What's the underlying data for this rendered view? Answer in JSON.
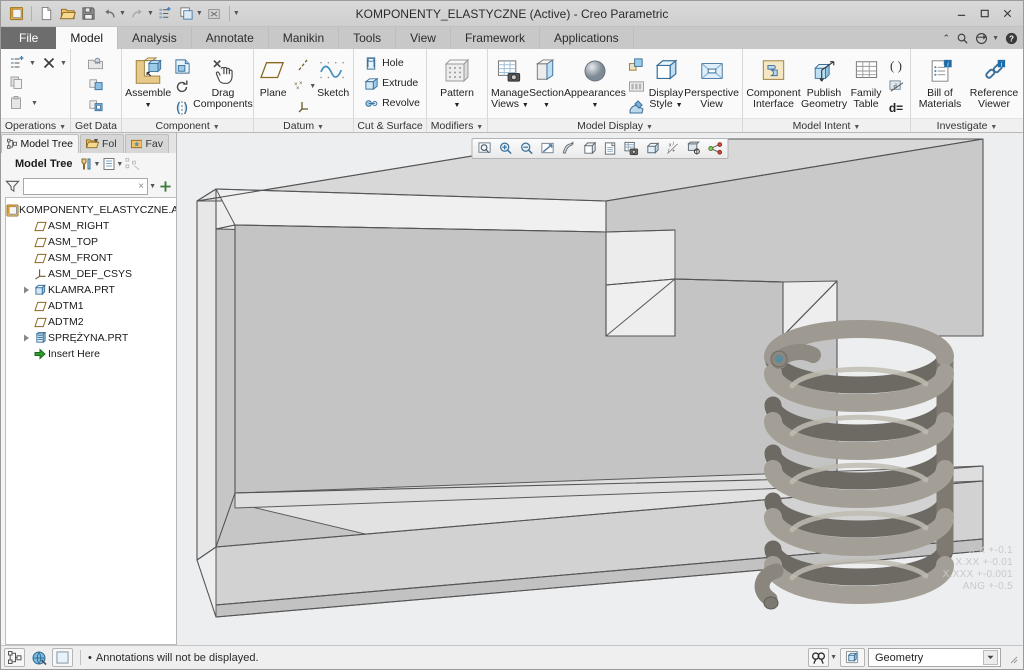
{
  "window": {
    "title": "KOMPONENTY_ELASTYCZNE (Active) - Creo Parametric",
    "minimize_label": "—",
    "maximize_label": "❑",
    "close_label": "✕"
  },
  "quick_access": {
    "items": [
      {
        "name": "creo-logo-icon",
        "label": "Creo"
      },
      {
        "name": "new-icon",
        "label": "New"
      },
      {
        "name": "open-icon",
        "label": "Open"
      },
      {
        "name": "save-icon",
        "label": "Save"
      },
      {
        "name": "undo-icon",
        "label": "Undo"
      },
      {
        "name": "redo-icon",
        "label": "Redo"
      },
      {
        "name": "regenerate-icon",
        "label": "Regenerate"
      },
      {
        "name": "window-switch-icon",
        "label": "Switch Window"
      },
      {
        "name": "close-window-icon",
        "label": "Close"
      },
      {
        "name": "customize-qat-icon",
        "label": "Customize Quick Access Toolbar"
      }
    ]
  },
  "tabs": [
    {
      "label": "File",
      "active": false,
      "file": true
    },
    {
      "label": "Model",
      "active": true
    },
    {
      "label": "Analysis",
      "active": false
    },
    {
      "label": "Annotate",
      "active": false
    },
    {
      "label": "Manikin",
      "active": false
    },
    {
      "label": "Tools",
      "active": false
    },
    {
      "label": "View",
      "active": false
    },
    {
      "label": "Framework",
      "active": false
    },
    {
      "label": "Applications",
      "active": false
    }
  ],
  "tab_right_icons": [
    {
      "name": "collapse-ribbon-icon",
      "label": "Collapse Ribbon"
    },
    {
      "name": "search-icon",
      "label": "Search"
    },
    {
      "name": "refresh-icon",
      "label": "Refresh"
    },
    {
      "name": "help-icon",
      "label": "Help"
    }
  ],
  "ribbon": {
    "groups": [
      {
        "title": "Operations",
        "dropdown": true,
        "small_items": [
          {
            "label": "",
            "name": "regenerate-button",
            "dropdown": true
          },
          {
            "label": "",
            "name": "delete-button",
            "dropdown": true
          },
          {
            "label": "",
            "name": "copy-button"
          },
          {
            "label": "",
            "name": "paste-button",
            "dropdown": true
          }
        ]
      },
      {
        "title": "Get Data",
        "dropdown": true,
        "small_items": [
          {
            "label": "",
            "name": "import-button"
          },
          {
            "label": "",
            "name": "merge-inheritance-button"
          },
          {
            "label": "",
            "name": "shrinkwrap-button"
          }
        ]
      },
      {
        "title": "Component",
        "dropdown": true,
        "big_items": [
          {
            "label": "Assemble",
            "name": "assemble-button",
            "dropdown": true
          },
          {
            "label": "Drag\nComponents",
            "name": "drag-components-button"
          }
        ],
        "small_items": [
          {
            "label": "",
            "name": "create-component-button"
          },
          {
            "label": "",
            "name": "repeat-button"
          },
          {
            "label": "",
            "name": "mirror-component-button"
          }
        ]
      },
      {
        "title": "Datum",
        "dropdown": true,
        "big_items": [
          {
            "label": "Plane",
            "name": "plane-button"
          },
          {
            "label": "Sketch",
            "name": "sketch-button"
          }
        ]
      },
      {
        "title": "Cut & Surface",
        "dropdown": true,
        "small_items": [
          {
            "label": "Hole",
            "name": "hole-button"
          },
          {
            "label": "Extrude",
            "name": "extrude-button"
          },
          {
            "label": "Revolve",
            "name": "revolve-button"
          }
        ]
      },
      {
        "title": "Modifiers",
        "dropdown": true,
        "big_items": [
          {
            "label": "Pattern",
            "name": "pattern-button",
            "dropdown": true
          }
        ]
      },
      {
        "title": "Model Display",
        "dropdown": true,
        "big_items": [
          {
            "label": "Manage\nViews",
            "name": "manage-views-button",
            "dropdown": true
          },
          {
            "label": "Section",
            "name": "section-button",
            "dropdown": true
          },
          {
            "label": "Appearances",
            "name": "appearances-button",
            "dropdown": true
          },
          {
            "label": "Display\nStyle",
            "name": "display-style-button",
            "dropdown": true
          },
          {
            "label": "Perspective\nView",
            "name": "perspective-view-button"
          }
        ]
      },
      {
        "title": "Model Intent",
        "dropdown": true,
        "big_items": [
          {
            "label": "Component\nInterface",
            "name": "component-interface-button"
          },
          {
            "label": "Publish\nGeometry",
            "name": "publish-geometry-button"
          },
          {
            "label": "Family\nTable",
            "name": "family-table-button"
          }
        ],
        "small_items": [
          {
            "label": "",
            "name": "parameters-button"
          },
          {
            "label": "",
            "name": "relations-button"
          },
          {
            "label": "",
            "name": "dimension-button"
          }
        ]
      },
      {
        "title": "Investigate",
        "dropdown": true,
        "big_items": [
          {
            "label": "Bill of\nMaterials",
            "name": "bill-of-materials-button"
          },
          {
            "label": "Reference\nViewer",
            "name": "reference-viewer-button"
          }
        ]
      }
    ]
  },
  "navigator": {
    "tabs": [
      {
        "label": "Model Tree",
        "name": "nav-tab-model-tree",
        "icon": "model-tree-icon",
        "active": true
      },
      {
        "label": "Fol",
        "name": "nav-tab-folder-browser",
        "icon": "folder-icon",
        "active": false
      },
      {
        "label": "Fav",
        "name": "nav-tab-favorites",
        "icon": "favorites-icon",
        "active": false
      }
    ],
    "header": {
      "title": "Model Tree",
      "icons": [
        {
          "name": "tree-settings-icon",
          "label": "Settings",
          "dropdown": true
        },
        {
          "name": "tree-display-icon",
          "label": "Display",
          "dropdown": true
        },
        {
          "name": "tree-filter-off-icon",
          "label": "Filter"
        }
      ]
    },
    "filter": {
      "placeholder": "",
      "value": "",
      "clear_label": "×",
      "icons": [
        {
          "name": "filter-icon",
          "label": "Filter"
        },
        {
          "name": "filter-dropdown-icon",
          "label": "Filter options"
        },
        {
          "name": "add-filter-icon",
          "label": "Add"
        }
      ]
    },
    "tree_items": [
      {
        "label": "KOMPONENTY_ELASTYCZNE.ASM",
        "icon": "assembly-icon",
        "indent": 0,
        "expander": "none"
      },
      {
        "label": "ASM_RIGHT",
        "icon": "datum-plane-icon",
        "indent": 1,
        "expander": "none"
      },
      {
        "label": "ASM_TOP",
        "icon": "datum-plane-icon",
        "indent": 1,
        "expander": "none"
      },
      {
        "label": "ASM_FRONT",
        "icon": "datum-plane-icon",
        "indent": 1,
        "expander": "none"
      },
      {
        "label": "ASM_DEF_CSYS",
        "icon": "coordinate-system-icon",
        "indent": 1,
        "expander": "none"
      },
      {
        "label": "KLAMRA.PRT",
        "icon": "part-icon",
        "indent": 1,
        "expander": "collapsed"
      },
      {
        "label": "ADTM1",
        "icon": "datum-plane-icon",
        "indent": 1,
        "expander": "none"
      },
      {
        "label": "ADTM2",
        "icon": "datum-plane-icon",
        "indent": 1,
        "expander": "none"
      },
      {
        "label": "SPRĘŻYNA.PRT",
        "icon": "flexible-part-icon",
        "indent": 1,
        "expander": "collapsed"
      },
      {
        "label": "Insert Here",
        "icon": "insert-here-icon",
        "indent": 1,
        "expander": "none"
      }
    ]
  },
  "graphics_toolbar": {
    "buttons": [
      {
        "name": "refit-icon",
        "label": "Refit"
      },
      {
        "name": "zoom-in-icon",
        "label": "Zoom In"
      },
      {
        "name": "zoom-out-icon",
        "label": "Zoom Out"
      },
      {
        "name": "repaint-icon",
        "label": "Repaint"
      },
      {
        "name": "datum-display-icon",
        "label": "Datum Display Filters"
      },
      {
        "name": "display-style-icon",
        "label": "Display Style"
      },
      {
        "name": "saved-orientations-icon",
        "label": "Saved Orientations"
      },
      {
        "name": "view-manager-icon",
        "label": "View Manager"
      },
      {
        "name": "perspective-icon",
        "label": "Perspective View"
      },
      {
        "name": "annotation-display-icon",
        "label": "Annotation Display"
      },
      {
        "name": "spin-center-icon",
        "label": "Spin Center"
      },
      {
        "name": "drag-packaged-icon",
        "label": "Drag Packaged Components"
      }
    ]
  },
  "viewport": {
    "tolerance_lines": [
      "X.X +-0.1",
      "X.XX +-0.01",
      "X.XXX +-0.001",
      "ANG +-0.5"
    ],
    "colors": {
      "background": "#eceef0",
      "bracket_face": "#c9c9c9",
      "bracket_top": "#d6d6d6",
      "bracket_light": "#e9e9e9",
      "spring": "#8e8a82",
      "edge": "#5a5a5a"
    }
  },
  "status_bar": {
    "left_icons": [
      {
        "name": "model-tree-toggle-icon",
        "label": "Model Tree"
      },
      {
        "name": "web-browser-icon",
        "label": "Browser"
      },
      {
        "name": "graphics-window-icon",
        "label": "Graphics Window"
      }
    ],
    "message": "Annotations will not be displayed.",
    "message_bullet": "•",
    "right_icons": [
      {
        "name": "search-tool-icon",
        "label": "Search",
        "dropdown": true
      },
      {
        "name": "active-window-icon",
        "label": "Active Window"
      }
    ],
    "selection_filter": {
      "value": "Geometry",
      "arrow": "▾"
    }
  }
}
